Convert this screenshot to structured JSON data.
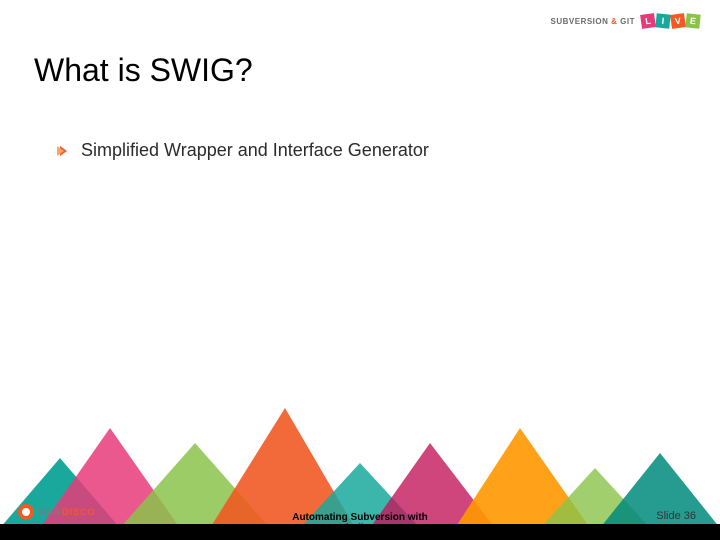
{
  "header": {
    "logo_text_left": "SUBVERSION",
    "logo_amp": "&",
    "logo_text_right": "GIT",
    "live_letters": [
      "L",
      "I",
      "V",
      "E"
    ],
    "live_colors": [
      "#e63b7a",
      "#1aa89c",
      "#f15a24",
      "#8bc34a"
    ]
  },
  "title": "What is SWIG?",
  "bullets": [
    "Simplified Wrapper and Interface Generator"
  ],
  "footer": {
    "subtitle": "Automating Subversion with\nBindings",
    "slide_label": "Slide 36",
    "brand_left": "WAN",
    "brand_right": "DISCO"
  }
}
